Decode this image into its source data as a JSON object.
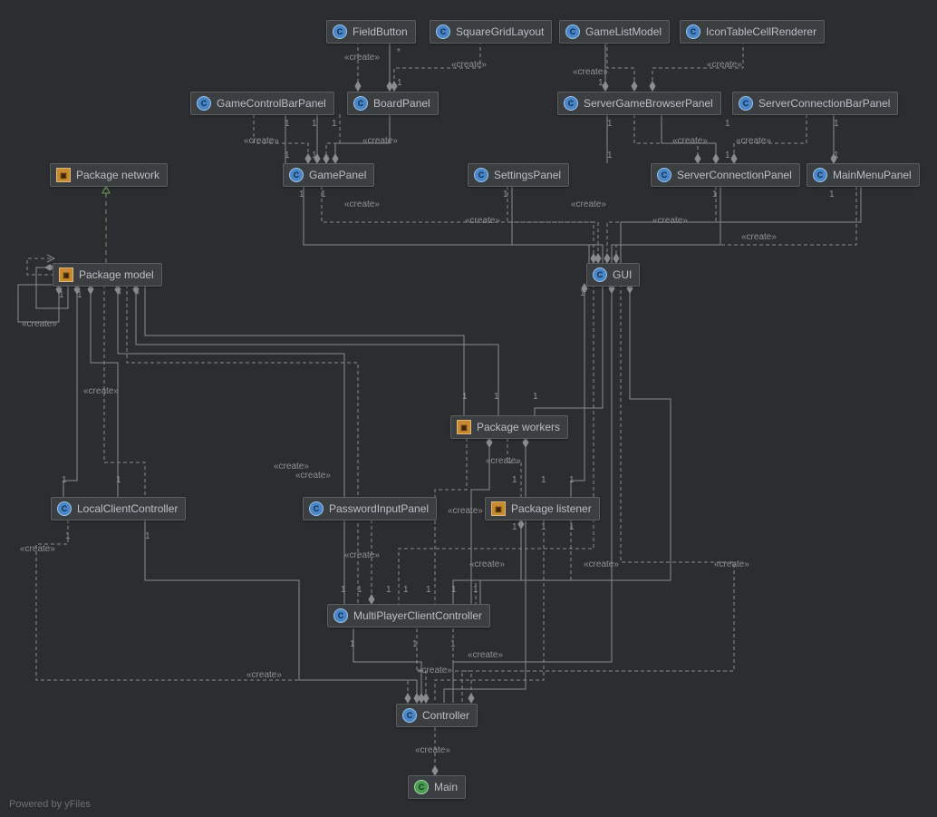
{
  "nodes": {
    "FieldButton": "FieldButton",
    "SquareGridLayout": "SquareGridLayout",
    "GameListModel": "GameListModel",
    "IconTableCellRenderer": "IconTableCellRenderer",
    "GameControlBarPanel": "GameControlBarPanel",
    "BoardPanel": "BoardPanel",
    "ServerGameBrowserPanel": "ServerGameBrowserPanel",
    "ServerConnectionBarPanel": "ServerConnectionBarPanel",
    "PackageNetwork": "Package network",
    "GamePanel": "GamePanel",
    "SettingsPanel": "SettingsPanel",
    "ServerConnectionPanel": "ServerConnectionPanel",
    "MainMenuPanel": "MainMenuPanel",
    "PackageModel": "Package model",
    "GUI": "GUI",
    "PackageWorkers": "Package workers",
    "LocalClientController": "LocalClientController",
    "PasswordInputPanel": "PasswordInputPanel",
    "PackageListener": "Package listener",
    "MultiPlayerClientController": "MultiPlayerClientController",
    "Controller": "Controller",
    "Main": "Main"
  },
  "labels": {
    "create": "«create»",
    "one": "1",
    "star": "*"
  },
  "footer": "Powered by yFiles"
}
